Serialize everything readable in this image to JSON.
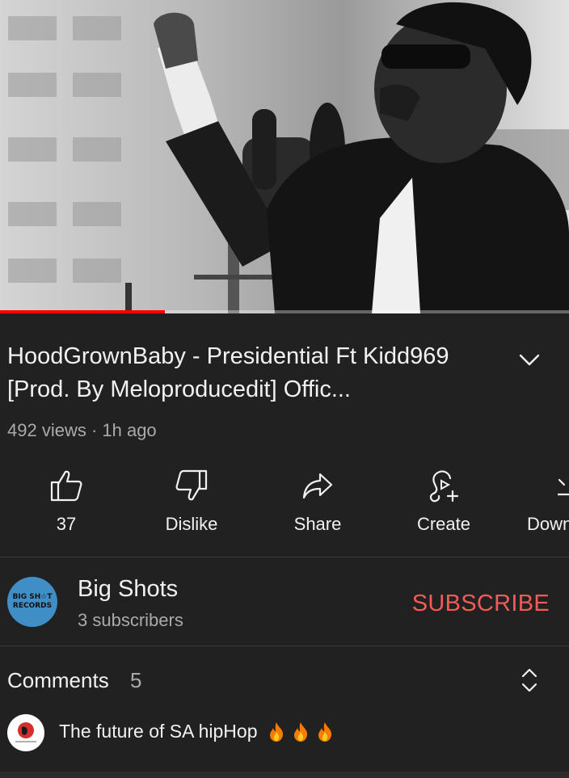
{
  "video": {
    "progress": 0.29,
    "progress_color": "#ff0000"
  },
  "video_info": {
    "title": "HoodGrownBaby - Presidential Ft Kidd969 [Prod. By Meloproducedit] Offic...",
    "meta": "492 views · 1h ago",
    "expand_icon": "chevron-down-icon"
  },
  "actions": [
    {
      "icon": "thumbs-up-icon",
      "label": "37"
    },
    {
      "icon": "thumbs-down-icon",
      "label": "Dislike"
    },
    {
      "icon": "share-icon",
      "label": "Share"
    },
    {
      "icon": "create-icon",
      "label": "Create"
    },
    {
      "icon": "download-icon",
      "label": "Down"
    }
  ],
  "channel": {
    "name": "Big Shots",
    "subscribers": "3 subscribers",
    "avatar_text_1": "BIG SH☆T",
    "avatar_text_2": "RECORDS",
    "subscribe_label": "SUBSCRIBE",
    "subscribe_color": "#f25c54"
  },
  "comments": {
    "label": "Comments",
    "count": "5",
    "sort_icon": "unfold-icon",
    "top_comment": {
      "text": "The future of SA hipHop",
      "emoji": "🔥🔥🔥"
    }
  },
  "colors": {
    "background": "#212121",
    "text": "#f1f1f1",
    "secondary_text": "#aaaaaa"
  }
}
